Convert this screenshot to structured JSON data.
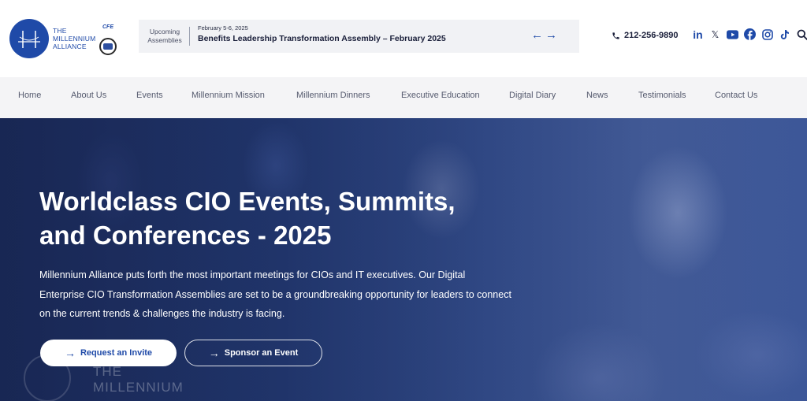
{
  "brand": {
    "logo_line1": "THE",
    "logo_line2": "MILLENNIUM",
    "logo_line3": "ALLIANCE",
    "badge_cfe": "CFE",
    "color": "#1f4aa8"
  },
  "ticker": {
    "kind_line1": "Upcoming",
    "kind_line2": "Assemblies",
    "date": "February 5-6, 2025",
    "title": "Benefits Leadership Transformation Assembly – February 2025",
    "prev_icon": "arrow-left-icon",
    "next_icon": "arrow-right-icon"
  },
  "contact": {
    "phone": "212-256-9890"
  },
  "socials": [
    "linkedin",
    "x",
    "youtube",
    "facebook",
    "instagram",
    "tiktok",
    "search"
  ],
  "nav": {
    "items": [
      "Home",
      "About Us",
      "Events",
      "Millennium Mission",
      "Millennium Dinners",
      "Executive Education",
      "Digital Diary",
      "News",
      "Testimonials",
      "Contact Us"
    ]
  },
  "hero": {
    "title_line1": "Worldclass CIO Events, Summits,",
    "title_line2": "and Conferences - 2025",
    "description": "Millennium Alliance puts forth the most important meetings for CIOs and IT executives. Our Digital Enterprise CIO Transformation Assemblies are set to be a groundbreaking opportunity for leaders to connect on the current trends & challenges the industry is facing.",
    "cta_primary": "Request an Invite",
    "cta_secondary": "Sponsor an Event",
    "watermark_line1": "THE",
    "watermark_line2": "MILLENNIUM"
  }
}
